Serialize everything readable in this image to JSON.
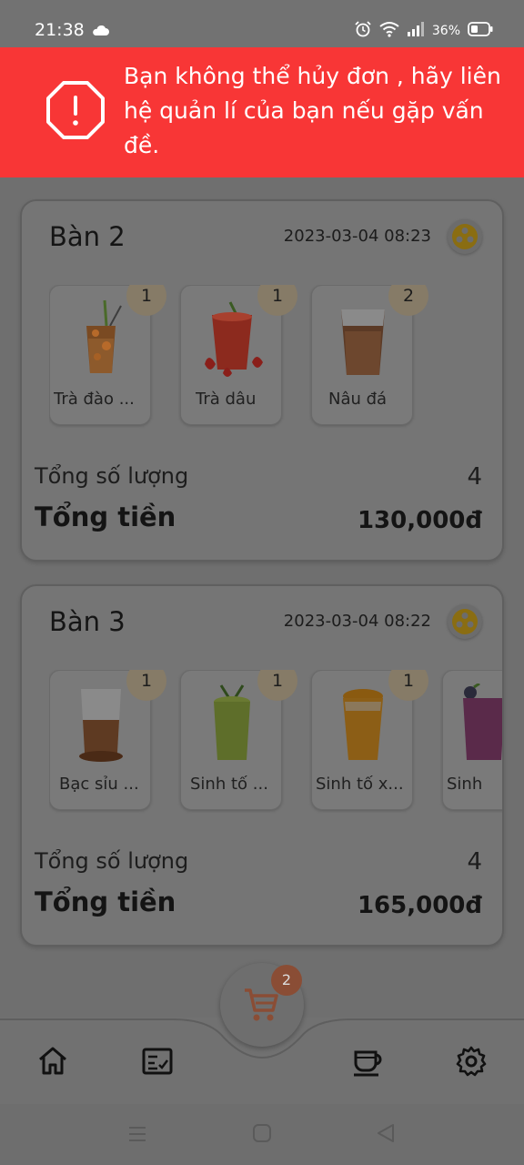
{
  "status_bar": {
    "time": "21:38",
    "battery": "36%"
  },
  "toast": {
    "message": "Bạn không thể hủy đơn , hãy liên hệ quản lí của bạn nếu gặp vấn đề."
  },
  "orders": [
    {
      "table": "Bàn 2",
      "time": "2023-03-04 08:23",
      "items": [
        {
          "name": "Trà đào ...",
          "qty": "1"
        },
        {
          "name": "Trà dâu",
          "qty": "1"
        },
        {
          "name": "Nâu đá",
          "qty": "2"
        }
      ],
      "total_qty_label": "Tổng số lượng",
      "total_qty": "4",
      "total_price_label": "Tổng tiền",
      "total_price": "130,000đ"
    },
    {
      "table": "Bàn 3",
      "time": "2023-03-04 08:22",
      "items": [
        {
          "name": "Bạc sỉu ...",
          "qty": "1"
        },
        {
          "name": "Sinh tố ...",
          "qty": "1"
        },
        {
          "name": "Sinh tố x...",
          "qty": "1"
        },
        {
          "name": "Sinh",
          "qty": ""
        }
      ],
      "total_qty_label": "Tổng số lượng",
      "total_qty": "4",
      "total_price_label": "Tổng tiền",
      "total_price": "165,000đ"
    }
  ],
  "cart": {
    "badge": "2"
  },
  "nav": {
    "icons": [
      "home-icon",
      "order-list-icon",
      "coffee-cup-icon",
      "settings-gear-icon"
    ]
  },
  "colors": {
    "toast_bg": "#f83636",
    "badge_bg": "#867b67",
    "cart_icon": "#8a4d35"
  }
}
